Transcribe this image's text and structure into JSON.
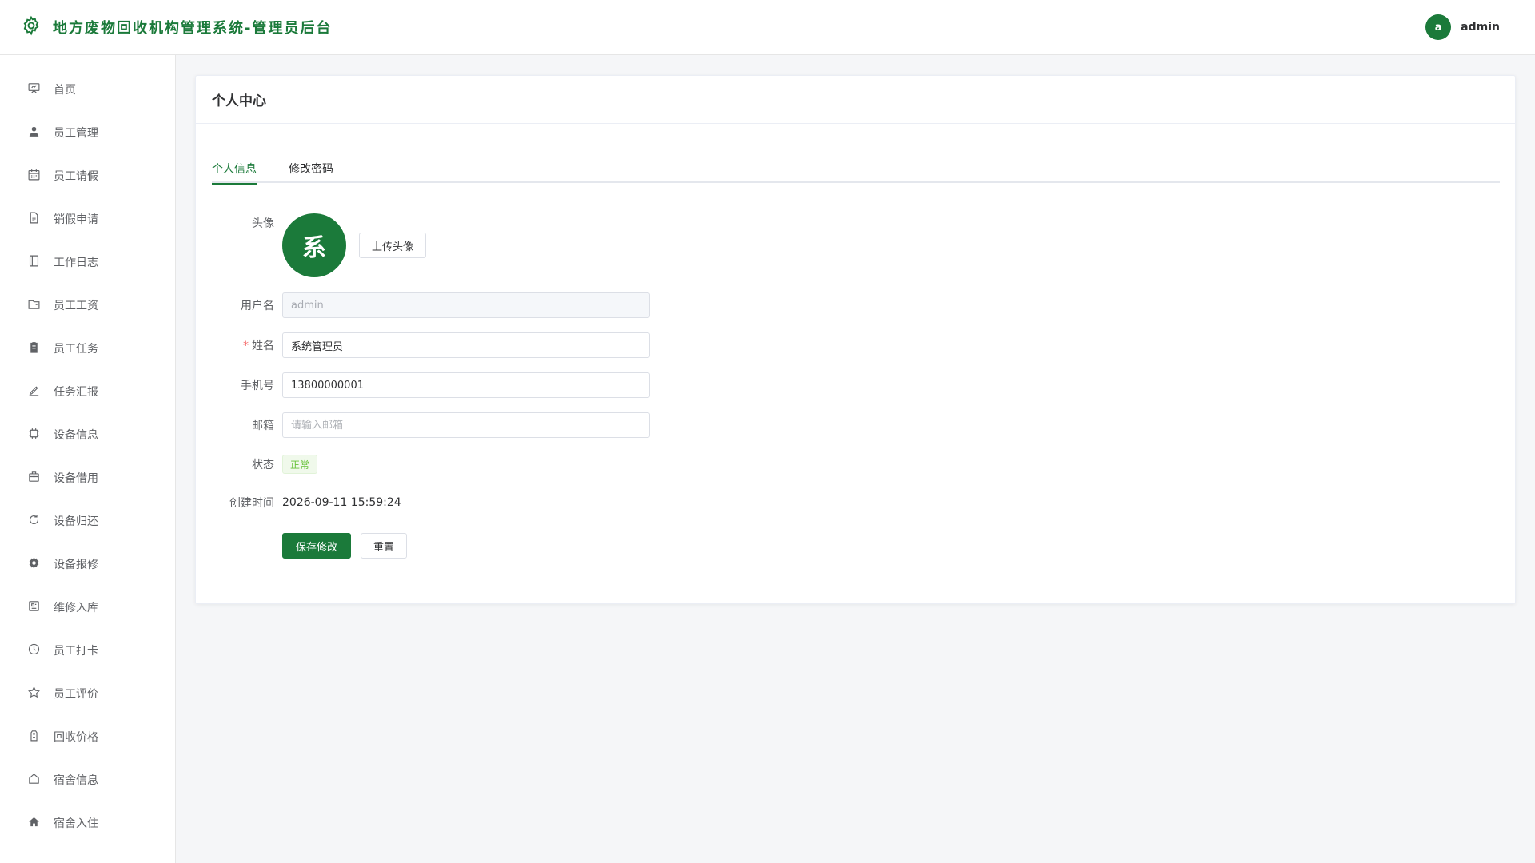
{
  "header": {
    "title": "地方废物回收机构管理系统-管理员后台",
    "user_avatar_letter": "a",
    "user_name": "admin",
    "accent_color": "#1b7a3a"
  },
  "sidebar": {
    "items": [
      {
        "label": "首页",
        "icon": "presentation-board-icon"
      },
      {
        "label": "员工管理",
        "icon": "user-icon"
      },
      {
        "label": "员工请假",
        "icon": "calendar-icon"
      },
      {
        "label": "销假申请",
        "icon": "document-icon"
      },
      {
        "label": "工作日志",
        "icon": "notebook-icon"
      },
      {
        "label": "员工工资",
        "icon": "wallet-folder-icon"
      },
      {
        "label": "员工任务",
        "icon": "clipboard-icon"
      },
      {
        "label": "任务汇报",
        "icon": "edit-pen-icon"
      },
      {
        "label": "设备信息",
        "icon": "cpu-chip-icon"
      },
      {
        "label": "设备借用",
        "icon": "box-icon"
      },
      {
        "label": "设备归还",
        "icon": "refresh-icon"
      },
      {
        "label": "设备报修",
        "icon": "gear-icon"
      },
      {
        "label": "维修入库",
        "icon": "storage-icon"
      },
      {
        "label": "员工打卡",
        "icon": "clock-icon"
      },
      {
        "label": "员工评价",
        "icon": "star-icon"
      },
      {
        "label": "回收价格",
        "icon": "price-tag-icon"
      },
      {
        "label": "宿舍信息",
        "icon": "house-outline-icon"
      },
      {
        "label": "宿舍入住",
        "icon": "house-filled-icon"
      }
    ]
  },
  "main": {
    "card_title": "个人中心",
    "tabs": [
      {
        "label": "个人信息",
        "active": true
      },
      {
        "label": "修改密码",
        "active": false
      }
    ],
    "form": {
      "avatar_label": "头像",
      "avatar_text": "系",
      "upload_label": "上传头像",
      "username_label": "用户名",
      "username_value": "admin",
      "name_label": "姓名",
      "name_required_mark": "*",
      "name_value": "系统管理员",
      "phone_label": "手机号",
      "phone_value": "13800000001",
      "email_label": "邮箱",
      "email_placeholder": "请输入邮箱",
      "status_label": "状态",
      "status_value": "正常",
      "created_label": "创建时间",
      "created_value": "2026-09-11 15:59:24",
      "save_label": "保存修改",
      "reset_label": "重置"
    }
  }
}
